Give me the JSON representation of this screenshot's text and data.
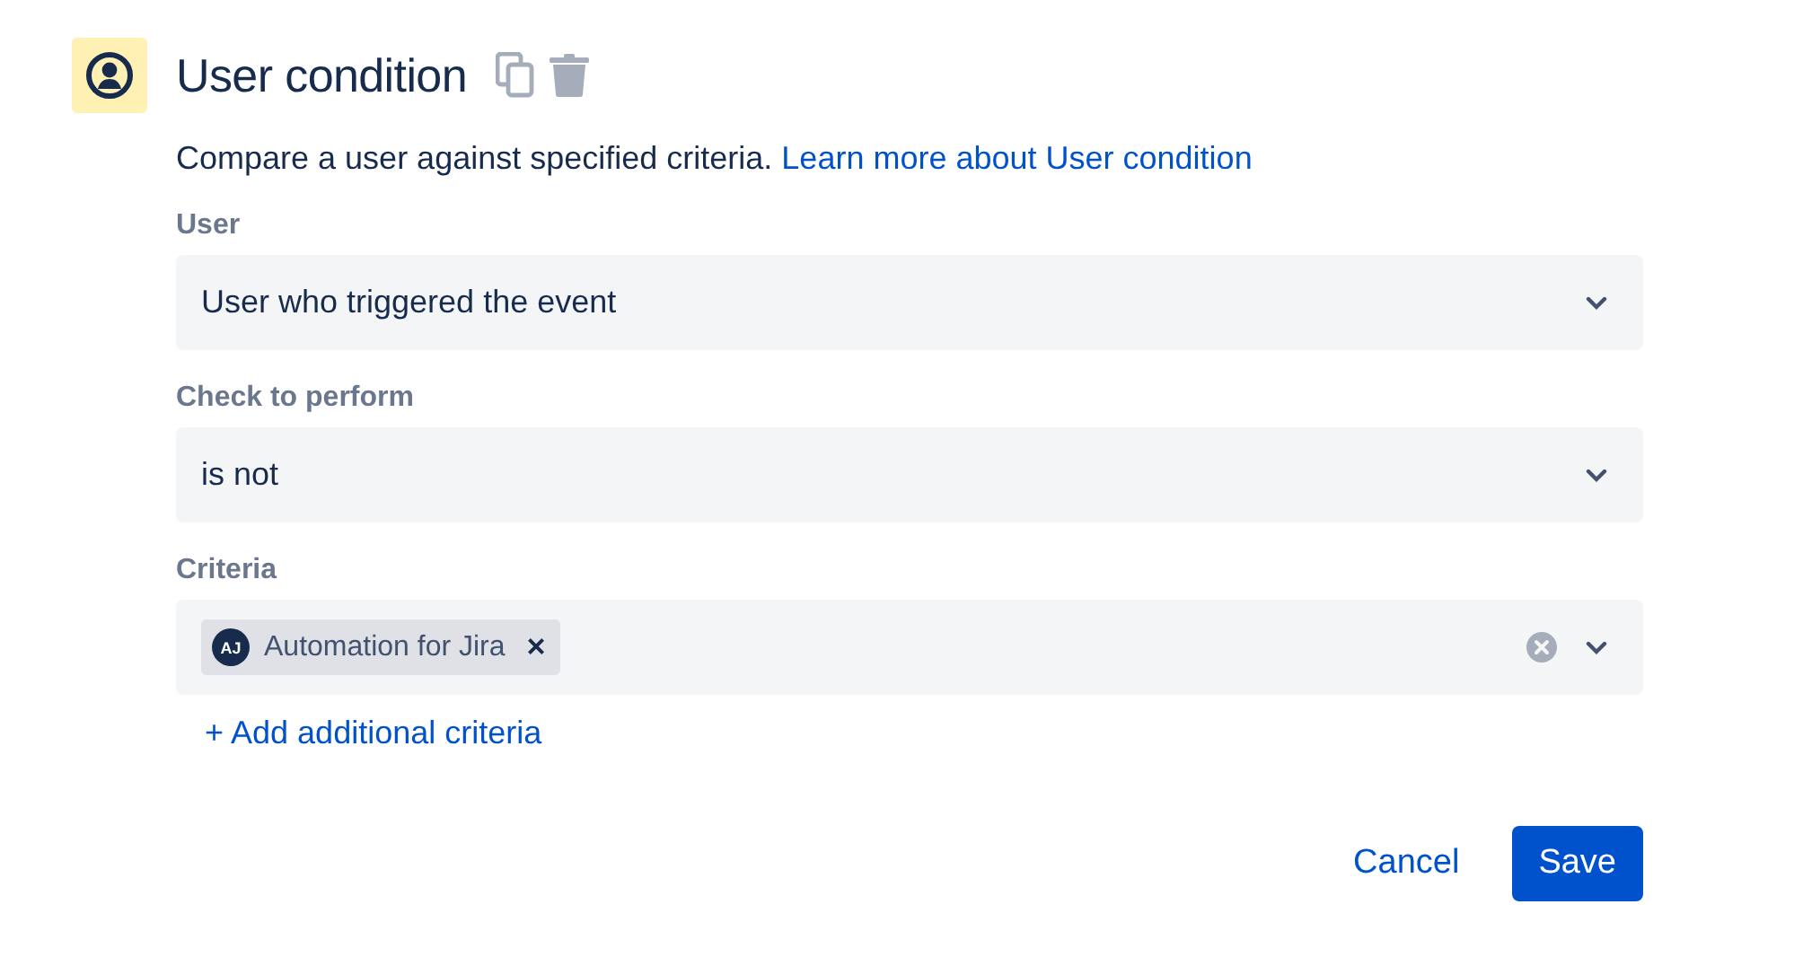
{
  "header": {
    "title": "User condition"
  },
  "description": {
    "text": "Compare a user against specified criteria.",
    "link": "Learn more about User condition"
  },
  "fields": [
    {
      "kind": "select",
      "label": "User",
      "value": "User who triggered the event"
    },
    {
      "kind": "select",
      "label": "Check to perform",
      "value": "is not"
    },
    {
      "kind": "multi",
      "label": "Criteria",
      "chips": [
        {
          "initials": "AJ",
          "label": "Automation for Jira",
          "remove": "×"
        }
      ]
    }
  ],
  "add_link": "+ Add additional criteria",
  "buttons": [
    {
      "label": "Cancel",
      "kind": "subtle"
    },
    {
      "label": "Save",
      "kind": "primary"
    }
  ]
}
